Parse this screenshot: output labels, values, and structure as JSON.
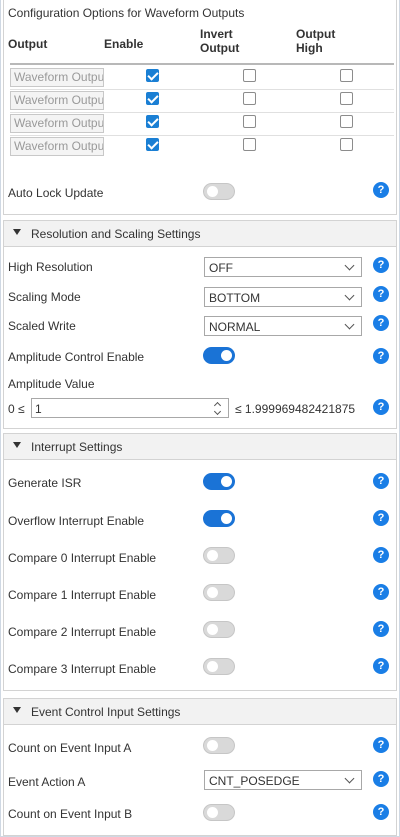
{
  "waveform": {
    "title": "Configuration Options for Waveform Outputs",
    "col_output": "Output",
    "col_enable": "Enable",
    "col_invert_1": "Invert",
    "col_invert_2": "Output",
    "col_high_1": "Output",
    "col_high_2": "High",
    "rows": [
      {
        "name": "Waveform Outpu",
        "enable": true,
        "invert": false,
        "high": false
      },
      {
        "name": "Waveform Outpu",
        "enable": true,
        "invert": false,
        "high": false
      },
      {
        "name": "Waveform Outpu",
        "enable": true,
        "invert": false,
        "high": false
      },
      {
        "name": "Waveform Outpu",
        "enable": true,
        "invert": false,
        "high": false
      }
    ],
    "auto_lock_label": "Auto Lock Update",
    "auto_lock_on": false
  },
  "resolution": {
    "title": "Resolution and Scaling Settings",
    "high_res_label": "High Resolution",
    "high_res_value": "OFF",
    "scaling_mode_label": "Scaling Mode",
    "scaling_mode_value": "BOTTOM",
    "scaled_write_label": "Scaled Write",
    "scaled_write_value": "NORMAL",
    "amp_ctrl_label": "Amplitude Control Enable",
    "amp_ctrl_on": true,
    "amp_value_label": "Amplitude Value",
    "amp_min": "0 ≤",
    "amp_value": "1",
    "amp_max": "≤ 1.999969482421875"
  },
  "interrupt": {
    "title": "Interrupt Settings",
    "items": [
      {
        "label": "Generate ISR",
        "on": true
      },
      {
        "label": "Overflow Interrupt Enable",
        "on": true
      },
      {
        "label": "Compare 0 Interrupt Enable",
        "on": false
      },
      {
        "label": "Compare 1 Interrupt Enable",
        "on": false
      },
      {
        "label": "Compare 2 Interrupt Enable",
        "on": false
      },
      {
        "label": "Compare 3 Interrupt Enable",
        "on": false
      }
    ]
  },
  "event": {
    "title": "Event Control Input Settings",
    "count_a_label": "Count on Event Input A",
    "count_a_on": false,
    "action_a_label": "Event Action A",
    "action_a_value": "CNT_POSEDGE",
    "count_b_label": "Count on Event Input B",
    "count_b_on": false
  },
  "help_glyph": "?",
  "colors": {
    "accent": "#1a73d6",
    "help": "#1a7ee6",
    "header_bg": "#f2f2f2"
  }
}
